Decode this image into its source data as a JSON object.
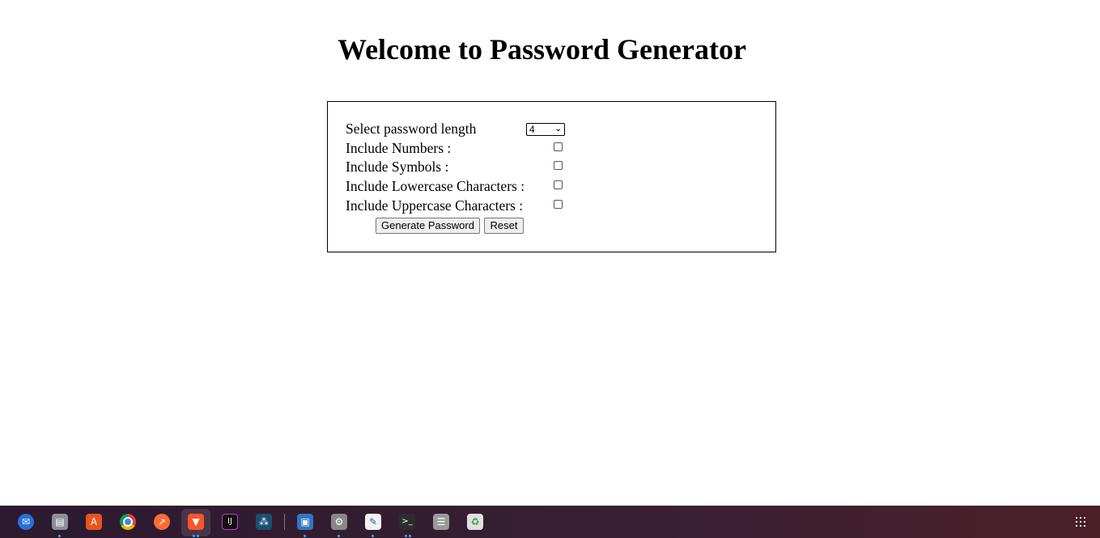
{
  "page": {
    "title": "Welcome to Password Generator"
  },
  "form": {
    "length_label": "Select password length",
    "length_value": "4",
    "numbers_label": "Include Numbers :",
    "symbols_label": "Include Symbols :",
    "lowercase_label": "Include Lowercase Characters :",
    "uppercase_label": "Include Uppercase Characters :",
    "generate_button": "Generate Password",
    "reset_button": "Reset"
  },
  "taskbar": {
    "icons": [
      "thunderbird-icon",
      "files-icon",
      "software-store-icon",
      "chrome-icon",
      "postman-icon",
      "brave-icon",
      "intellij-icon",
      "mysql-workbench-icon",
      "virtualbox-icon",
      "settings-icon",
      "text-editor-icon",
      "terminal-icon",
      "archive-icon",
      "trash-icon",
      "app-grid-icon"
    ]
  }
}
